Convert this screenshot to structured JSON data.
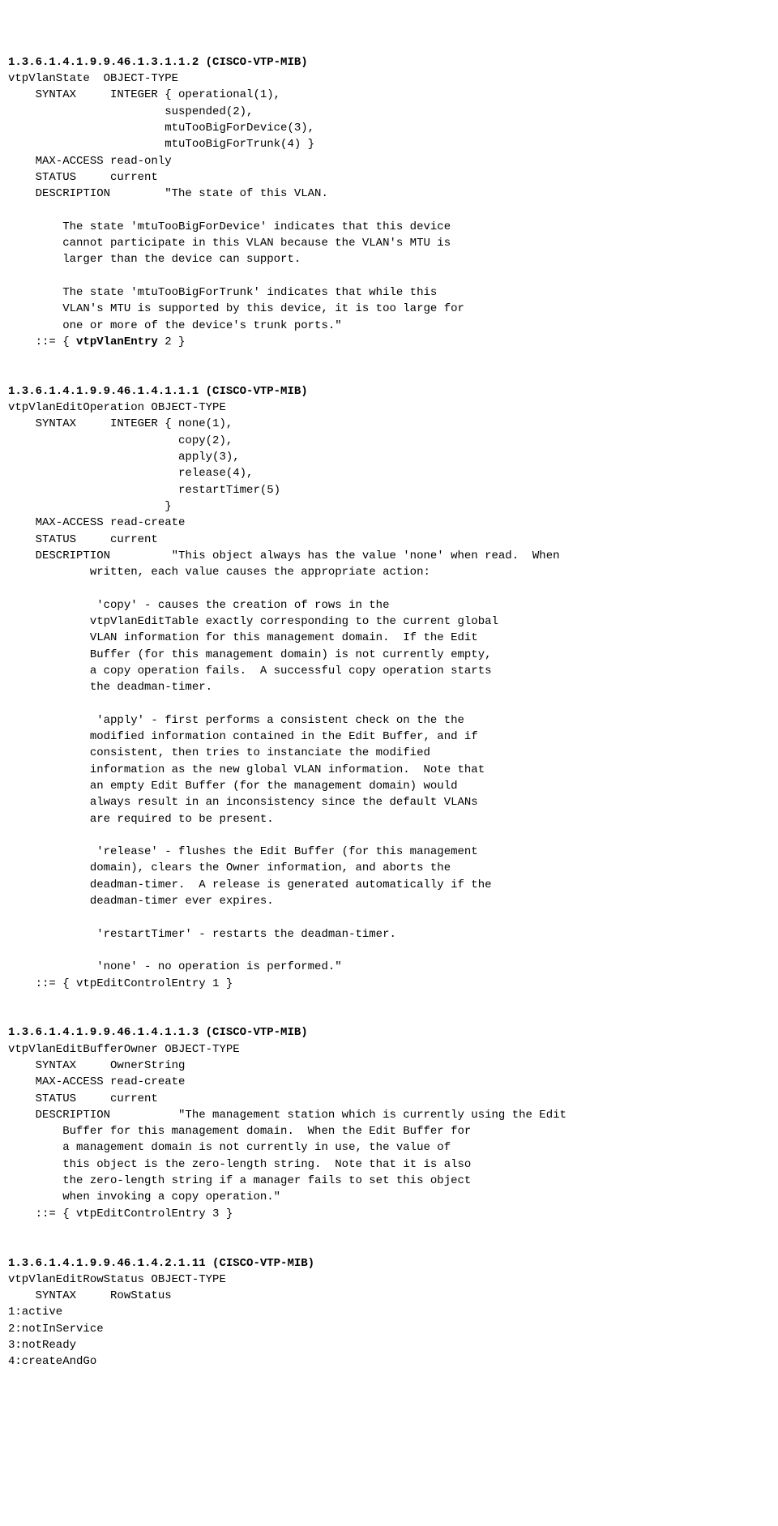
{
  "entries": [
    {
      "oid_heading": "1.3.6.1.4.1.9.9.46.1.3.1.1.2 (CISCO-VTP-MIB)",
      "body_lines": [
        "vtpVlanState  OBJECT-TYPE",
        "    SYNTAX     INTEGER { operational(1),",
        "                       suspended(2),",
        "                       mtuTooBigForDevice(3),",
        "                       mtuTooBigForTrunk(4) }",
        "    MAX-ACCESS read-only",
        "    STATUS     current",
        "    DESCRIPTION        \"The state of this VLAN.",
        "",
        "        The state 'mtuTooBigForDevice' indicates that this device",
        "        cannot participate in this VLAN because the VLAN's MTU is",
        "        larger than the device can support.",
        "",
        "        The state 'mtuTooBigForTrunk' indicates that while this",
        "        VLAN's MTU is supported by this device, it is too large for",
        "        one or more of the device's trunk ports.\""
      ],
      "assign_prefix": "    ::= { ",
      "assign_bold": "vtpVlanEntry",
      "assign_suffix": " 2 }"
    },
    {
      "oid_heading": "1.3.6.1.4.1.9.9.46.1.4.1.1.1 (CISCO-VTP-MIB)",
      "body_lines": [
        "vtpVlanEditOperation OBJECT-TYPE",
        "    SYNTAX     INTEGER { none(1),",
        "                         copy(2),",
        "                         apply(3),",
        "                         release(4),",
        "                         restartTimer(5)",
        "                       }",
        "    MAX-ACCESS read-create",
        "    STATUS     current",
        "    DESCRIPTION         \"This object always has the value 'none' when read.  When",
        "            written, each value causes the appropriate action:",
        "",
        "             'copy' - causes the creation of rows in the",
        "            vtpVlanEditTable exactly corresponding to the current global",
        "            VLAN information for this management domain.  If the Edit",
        "            Buffer (for this management domain) is not currently empty,",
        "            a copy operation fails.  A successful copy operation starts",
        "            the deadman-timer.",
        "",
        "             'apply' - first performs a consistent check on the the",
        "            modified information contained in the Edit Buffer, and if",
        "            consistent, then tries to instanciate the modified",
        "            information as the new global VLAN information.  Note that",
        "            an empty Edit Buffer (for the management domain) would",
        "            always result in an inconsistency since the default VLANs",
        "            are required to be present.",
        "",
        "             'release' - flushes the Edit Buffer (for this management",
        "            domain), clears the Owner information, and aborts the",
        "            deadman-timer.  A release is generated automatically if the",
        "            deadman-timer ever expires.",
        "",
        "             'restartTimer' - restarts the deadman-timer.",
        "",
        "             'none' - no operation is performed.\"",
        "    ::= { vtpEditControlEntry 1 }"
      ],
      "assign_prefix": "",
      "assign_bold": "",
      "assign_suffix": ""
    },
    {
      "oid_heading": "1.3.6.1.4.1.9.9.46.1.4.1.1.3 (CISCO-VTP-MIB)",
      "body_lines": [
        "vtpVlanEditBufferOwner OBJECT-TYPE",
        "    SYNTAX     OwnerString",
        "    MAX-ACCESS read-create",
        "    STATUS     current",
        "    DESCRIPTION          \"The management station which is currently using the Edit",
        "        Buffer for this management domain.  When the Edit Buffer for",
        "        a management domain is not currently in use, the value of",
        "        this object is the zero-length string.  Note that it is also",
        "        the zero-length string if a manager fails to set this object",
        "        when invoking a copy operation.\"",
        "    ::= { vtpEditControlEntry 3 }"
      ],
      "assign_prefix": "",
      "assign_bold": "",
      "assign_suffix": ""
    },
    {
      "oid_heading": "1.3.6.1.4.1.9.9.46.1.4.2.1.11 (CISCO-VTP-MIB)",
      "body_lines": [
        "vtpVlanEditRowStatus OBJECT-TYPE",
        "    SYNTAX     RowStatus",
        "1:active",
        "2:notInService",
        "3:notReady",
        "4:createAndGo"
      ],
      "assign_prefix": "",
      "assign_bold": "",
      "assign_suffix": ""
    }
  ]
}
